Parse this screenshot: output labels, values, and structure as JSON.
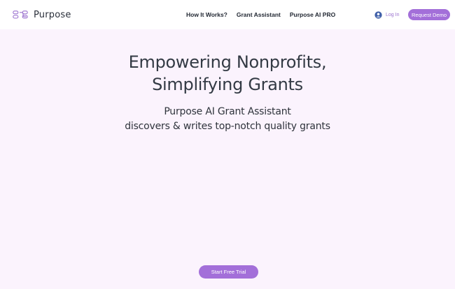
{
  "brand": {
    "name": "Purpose",
    "logo_icon": "purpose-logo-icon",
    "accent_color": "#a36fd9"
  },
  "nav": {
    "links": [
      {
        "label": "How It Works?"
      },
      {
        "label": "Grant Assistant"
      },
      {
        "label": "Purpose AI PRO"
      }
    ],
    "login_label": "Log In",
    "login_icon": "user-circle-icon",
    "demo_label": "Request Demo"
  },
  "hero": {
    "title_line1": "Empowering Nonprofits,",
    "title_line2": "Simplifying Grants",
    "subtitle_line1": "Purpose AI Grant Assistant",
    "subtitle_line2": "discovers & writes top-notch quality grants",
    "cta_label": "Start Free Trial"
  }
}
